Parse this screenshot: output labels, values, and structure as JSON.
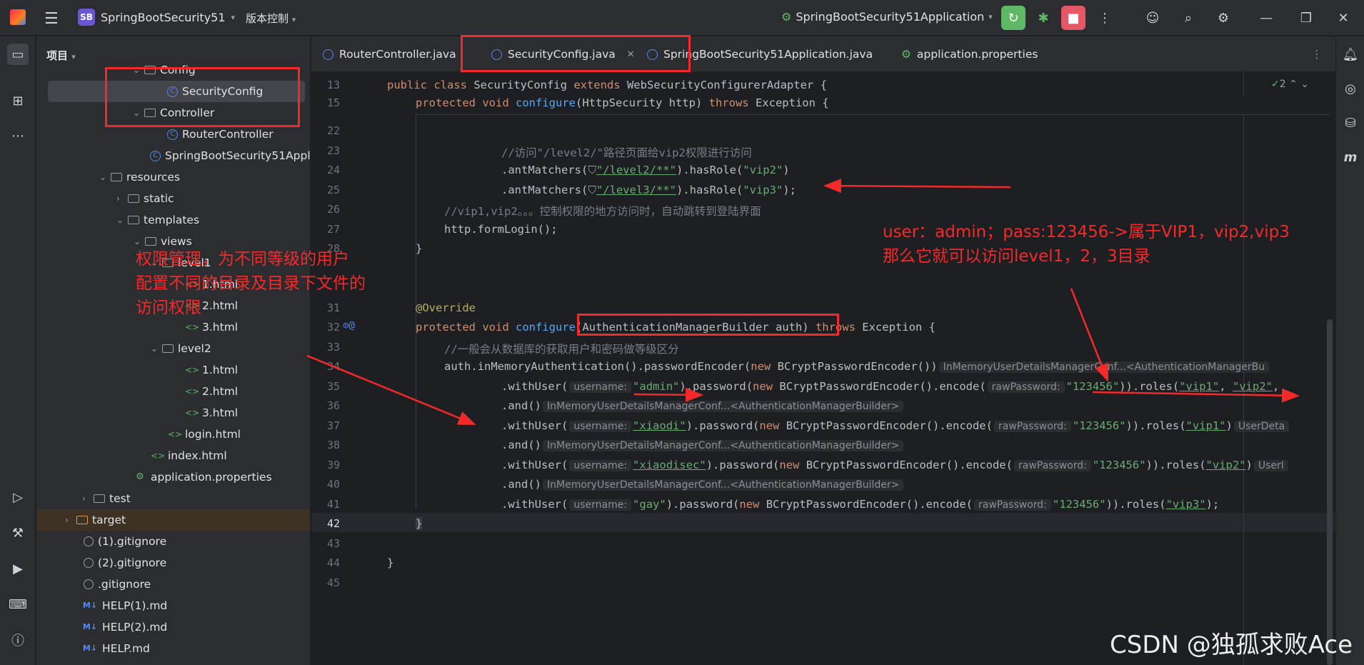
{
  "titlebar": {
    "project_badge": "SB",
    "project_name": "SpringBootSecurity51",
    "vcs_label": "版本控制",
    "run_config": "SpringBootSecurity51Application"
  },
  "project_panel": {
    "header": "项目",
    "rows": [
      {
        "label": "Config"
      },
      {
        "label": "SecurityConfig"
      },
      {
        "label": "Controller"
      },
      {
        "label": "RouterController"
      },
      {
        "label": "SpringBootSecurity51Appli"
      },
      {
        "label": "resources"
      },
      {
        "label": "static"
      },
      {
        "label": "templates"
      },
      {
        "label": "views"
      },
      {
        "label": "level1"
      },
      {
        "label": "1.html"
      },
      {
        "label": "2.html"
      },
      {
        "label": "3.html"
      },
      {
        "label": "level2"
      },
      {
        "label": "1.html"
      },
      {
        "label": "2.html"
      },
      {
        "label": "3.html"
      },
      {
        "label": "login.html"
      },
      {
        "label": "index.html"
      },
      {
        "label": "application.properties"
      },
      {
        "label": "test"
      },
      {
        "label": "target"
      },
      {
        "label": "(1).gitignore"
      },
      {
        "label": "(2).gitignore"
      },
      {
        "label": ".gitignore"
      },
      {
        "label": "HELP(1).md"
      },
      {
        "label": "HELP(2).md"
      },
      {
        "label": "HELP.md"
      }
    ]
  },
  "tabs": [
    {
      "label": "RouterController.java"
    },
    {
      "label": "SecurityConfig.java"
    },
    {
      "label": "SpringBootSecurity51Application.java"
    },
    {
      "label": "application.properties"
    }
  ],
  "editor": {
    "inspection_count": "2",
    "lines": {
      "n13": "13",
      "n15": "15",
      "n22": "22",
      "n23": "23",
      "n24": "24",
      "n25": "25",
      "n26": "26",
      "n27": "27",
      "n28": "28",
      "n31": "31",
      "n32": "32",
      "n33": "33",
      "n34": "34",
      "n35": "35",
      "n36": "36",
      "n37": "37",
      "n38": "38",
      "n39": "39",
      "n40": "40",
      "n41": "41",
      "n42": "42",
      "n43": "43",
      "n44": "44",
      "n45": "45"
    },
    "code": {
      "l13a": "public class ",
      "l13b": "SecurityConfig ",
      "l13c": "extends ",
      "l13d": "WebSecurityConfigurerAdapter {",
      "l15a": "protected void ",
      "l15b": "configure",
      "l15c": "(HttpSecurity http) ",
      "l15d": "throws ",
      "l15e": "Exception {",
      "l23": "//访问\"/level2/\"路径页面给vip2权限进行访问",
      "l24a": ".antMatchers(",
      "l24b": "\"/level2/**\"",
      "l24c": ").hasRole(",
      "l24d": "\"vip2\"",
      "l24e": ")",
      "l25a": ".antMatchers(",
      "l25b": "\"/level3/**\"",
      "l25c": ").hasRole(",
      "l25d": "\"vip3\"",
      "l25e": ");",
      "l26": "//vip1,vip2。。。控制权限的地方访问时，自动跳转到登陆界面",
      "l27": "http.formLogin();",
      "l28": "}",
      "l31": "@Override",
      "l32a": "protected void ",
      "l32b": "configure",
      "l32c": "(AuthenticationManagerBuilder auth)",
      "l32d": " throws ",
      "l32e": "Exception {",
      "l33": "//一般会从数据库的获取用户和密码做等级区分",
      "l34a": "auth.inMemoryAuthentication().passwordEncoder(",
      "l34b": "new ",
      "l34c": "BCryptPasswordEncoder())",
      "l34hint": "InMemoryUserDetailsManagerConf...<AuthenticationManagerBu",
      "l35a": ".withUser(",
      "l35h1": "username:",
      "l35b": "\"admin\"",
      "l35c": ").password(",
      "l35d": "new ",
      "l35e": "BCryptPasswordEncoder().encode(",
      "l35h2": "rawPassword:",
      "l35f": "\"123456\"",
      "l35g": ")).roles(",
      "l35i": "\"vip1\"",
      "l35j": ", ",
      "l35k": "\"vip2\"",
      "l35l": ",",
      "l36a": ".and()",
      "l36hint": "InMemoryUserDetailsManagerConf...<AuthenticationManagerBuilder>",
      "l37a": ".withUser(",
      "l37h1": "username:",
      "l37b": "\"xiaodi\"",
      "l37c": ").password(",
      "l37d": "new ",
      "l37e": "BCryptPasswordEncoder().encode(",
      "l37h2": "rawPassword:",
      "l37f": "\"123456\"",
      "l37g": ")).roles(",
      "l37i": "\"vip1\"",
      "l37j": ")",
      "l37k": "UserDeta",
      "l38a": ".and()",
      "l38hint": "InMemoryUserDetailsManagerConf...<AuthenticationManagerBuilder>",
      "l39a": ".withUser(",
      "l39h1": "username:",
      "l39b": "\"xiaodisec\"",
      "l39c": ").password(",
      "l39d": "new ",
      "l39e": "BCryptPasswordEncoder().encode(",
      "l39h2": "rawPassword:",
      "l39f": "\"123456\"",
      "l39g": ")).roles(",
      "l39i": "\"vip2\"",
      "l39j": ")",
      "l39k": "UserI",
      "l40a": ".and()",
      "l40hint": "InMemoryUserDetailsManagerConf...<AuthenticationManagerBuilder>",
      "l41a": ".withUser(",
      "l41h1": "username:",
      "l41b": "\"gay\"",
      "l41c": ").password(",
      "l41d": "new ",
      "l41e": "BCryptPasswordEncoder().encode(",
      "l41h2": "rawPassword:",
      "l41f": "\"123456\"",
      "l41g": ")).roles(",
      "l41i": "\"vip3\"",
      "l41j": ");",
      "l42": "}",
      "l44": "}"
    }
  },
  "annotations": {
    "left_note": [
      "权限管理，为不同等级的用户",
      "配置不同的目录及目录下文件的",
      "访问权限"
    ],
    "right_note": [
      "user：admin；pass:123456->属于VIP1，vip2,vip3",
      "那么它就可以访问level1，2，3目录"
    ],
    "color": "#f42a2a"
  },
  "watermark": "CSDN @独孤求败Ace",
  "colors": {
    "accent": "#3574f0",
    "run_green": "#5fb865",
    "stop_red": "#e55765"
  }
}
